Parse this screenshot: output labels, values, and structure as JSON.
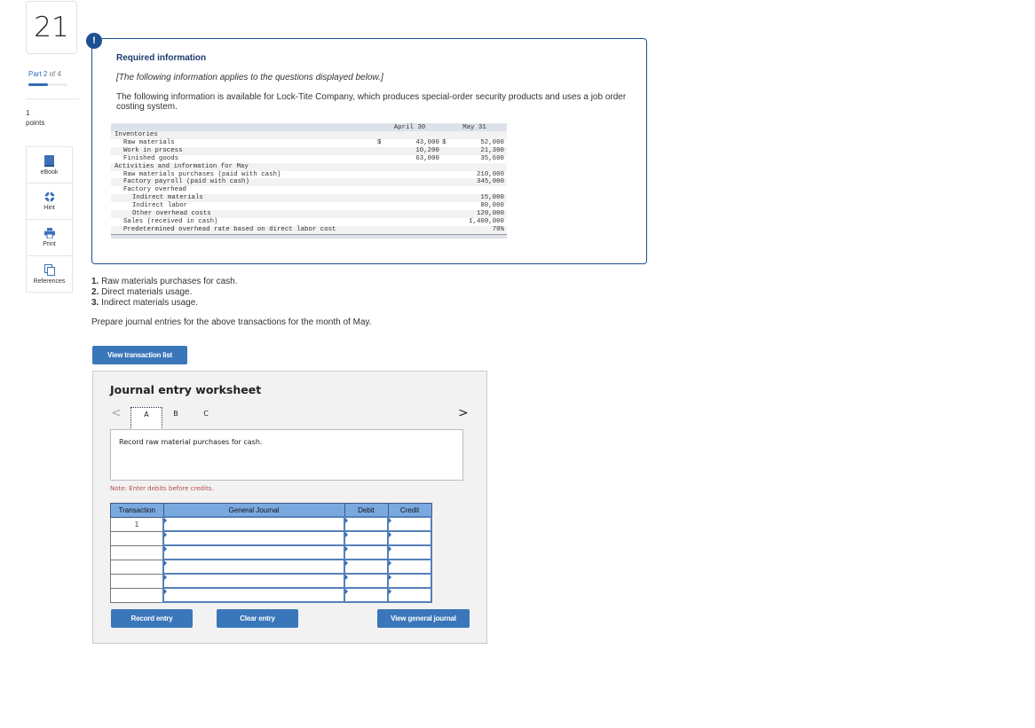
{
  "question": {
    "number": "21",
    "part_label": "Part 2",
    "part_of": "of 4",
    "progress_fraction": 0.5,
    "points_value": "1",
    "points_label": "points"
  },
  "tools": [
    {
      "label": "eBook",
      "icon": "book-icon"
    },
    {
      "label": "Hint",
      "icon": "lifebuoy-icon"
    },
    {
      "label": "Print",
      "icon": "printer-icon"
    },
    {
      "label": "References",
      "icon": "documents-icon"
    }
  ],
  "info": {
    "badge": "!",
    "title": "Required information",
    "italic_note": "[The following information applies to the questions displayed below.]",
    "description": "The following information is available for Lock-Tite Company, which produces special-order security products and uses a job order costing system.",
    "columns": [
      "April 30",
      "May 31"
    ],
    "rows": [
      {
        "label": "Inventories",
        "indent": 0,
        "apr_cur": "",
        "apr": "",
        "may_cur": "",
        "may": ""
      },
      {
        "label": "Raw materials",
        "indent": 1,
        "apr_cur": "$",
        "apr": "43,000",
        "may_cur": "$",
        "may": "52,000"
      },
      {
        "label": "Work in process",
        "indent": 1,
        "apr_cur": "",
        "apr": "10,200",
        "may_cur": "",
        "may": "21,300"
      },
      {
        "label": "Finished goods",
        "indent": 1,
        "apr_cur": "",
        "apr": "63,000",
        "may_cur": "",
        "may": "35,600"
      },
      {
        "label": "Activities and information for May",
        "indent": 0,
        "apr_cur": "",
        "apr": "",
        "may_cur": "",
        "may": ""
      },
      {
        "label": "Raw materials purchases (paid with cash)",
        "indent": 1,
        "apr_cur": "",
        "apr": "",
        "may_cur": "",
        "may": "210,000"
      },
      {
        "label": "Factory payroll (paid with cash)",
        "indent": 1,
        "apr_cur": "",
        "apr": "",
        "may_cur": "",
        "may": "345,000"
      },
      {
        "label": "Factory overhead",
        "indent": 1,
        "apr_cur": "",
        "apr": "",
        "may_cur": "",
        "may": ""
      },
      {
        "label": "Indirect materials",
        "indent": 2,
        "apr_cur": "",
        "apr": "",
        "may_cur": "",
        "may": "15,000"
      },
      {
        "label": "Indirect labor",
        "indent": 2,
        "apr_cur": "",
        "apr": "",
        "may_cur": "",
        "may": "80,000"
      },
      {
        "label": "Other overhead costs",
        "indent": 2,
        "apr_cur": "",
        "apr": "",
        "may_cur": "",
        "may": "120,000"
      },
      {
        "label": "Sales (received in cash)",
        "indent": 1,
        "apr_cur": "",
        "apr": "",
        "may_cur": "",
        "may": "1,400,000"
      },
      {
        "label": "Predetermined overhead rate based on direct labor cost",
        "indent": 1,
        "apr_cur": "",
        "apr": "",
        "may_cur": "",
        "may": "70%"
      }
    ]
  },
  "questions": [
    {
      "num": "1.",
      "text": "Raw materials purchases for cash."
    },
    {
      "num": "2.",
      "text": "Direct materials usage."
    },
    {
      "num": "3.",
      "text": "Indirect materials usage."
    }
  ],
  "prepare_text": "Prepare journal entries for the above transactions for the month of May.",
  "buttons": {
    "view_transaction_list": "View transaction list",
    "record_entry": "Record entry",
    "clear_entry": "Clear entry",
    "view_general_journal": "View general journal"
  },
  "worksheet": {
    "title": "Journal entry worksheet",
    "prev": "<",
    "next": ">",
    "tabs": [
      "A",
      "B",
      "C"
    ],
    "active_tab": "A",
    "description": "Record raw material purchases for cash.",
    "note": "Note: Enter debits before credits.",
    "headers": [
      "Transaction",
      "General Journal",
      "Debit",
      "Credit"
    ],
    "rows": [
      {
        "transaction": "1",
        "account": "",
        "debit": "",
        "credit": ""
      },
      {
        "transaction": "",
        "account": "",
        "debit": "",
        "credit": ""
      },
      {
        "transaction": "",
        "account": "",
        "debit": "",
        "credit": ""
      },
      {
        "transaction": "",
        "account": "",
        "debit": "",
        "credit": ""
      },
      {
        "transaction": "",
        "account": "",
        "debit": "",
        "credit": ""
      },
      {
        "transaction": "",
        "account": "",
        "debit": "",
        "credit": ""
      }
    ]
  },
  "colors": {
    "accent_blue": "#3a76ba",
    "dark_blue": "#1d4f91",
    "header_blue": "#7aa9e0",
    "note_red": "#b5494f"
  }
}
